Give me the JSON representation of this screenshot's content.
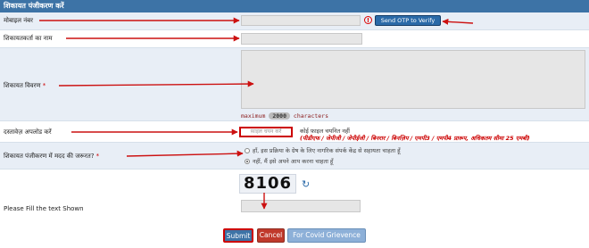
{
  "header": {
    "title": "शिकायत पंजीकरण करें"
  },
  "form": {
    "mobile": {
      "label": "मोबाइल नंबर",
      "value": ""
    },
    "otp_button": "Send OTP to Verify",
    "name": {
      "label": "शिकायतकर्ता का नाम",
      "value": ""
    },
    "description": {
      "label": "शिकायत विवरण",
      "maximum_label": "maximum",
      "maximum_value": "2000",
      "characters_label": "characters"
    },
    "upload": {
      "label": "दस्तावेज़ अपलोड करें",
      "button": "फ़ाइल चयन करें",
      "no_file_text": "कोई फ़ाइल चयनित नहीं",
      "file_types": "(पीडीएफ / जेपीजी / जेपीईजी / बिनरार / बिनज़िप / एमपी3 / एमपी4 प्रारूप, अधिकतम सीमा 25 एमबी)"
    },
    "help": {
      "label": "शिकायत पंजीकरण में मदद की जरूरत?",
      "options": [
        "हाँ, इस प्रक्रिया के ग्रेष के लिए नागरिक संपर्क केंद्र से सहायता चाहता हूँ",
        "नहीं, मैं इसे अपने आप करना चाहता हूँ"
      ],
      "selected_index": 1
    },
    "captcha": {
      "label": "Please Fill the text Shown",
      "code": "8106",
      "value": ""
    },
    "required_mark": "*"
  },
  "actions": {
    "submit": "Submit",
    "cancel": "Cancel",
    "covid": "For Covid Grievence"
  },
  "colors": {
    "header": "#3d73a6",
    "row_alt": "#e8eef6",
    "accent_red": "#cc0000",
    "button_blue": "#2b6aa8"
  }
}
